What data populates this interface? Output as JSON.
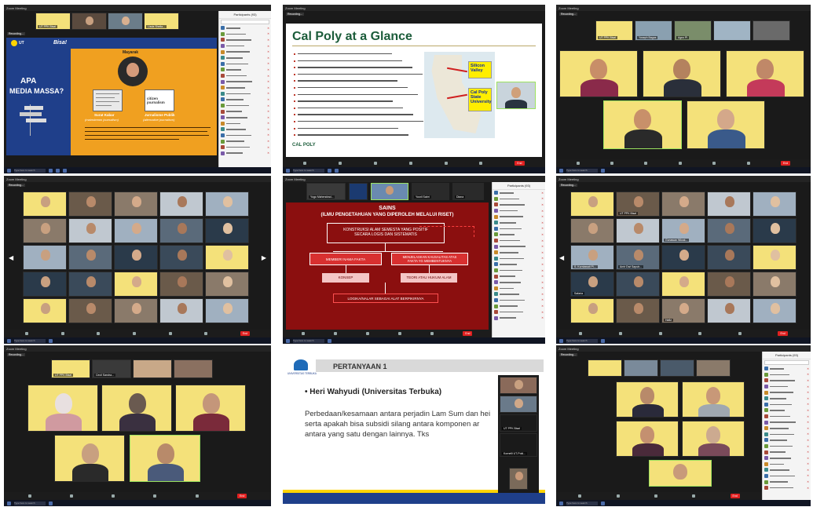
{
  "panel1": {
    "tile_names": [
      "UT PPK Bisa!",
      "",
      "Lisda Sheila..."
    ],
    "slide": {
      "question_line1": "APA",
      "question_line2": "MEDIA MASSA?",
      "center_label": "Mayarak",
      "left_caption_title": "Surat Kabar",
      "left_caption_sub": "(mainstream journalism)",
      "right_caption_title": "Jurnalisme Publik",
      "right_caption_sub": "(alternative journalism)",
      "citizen_label": "citizen journalism",
      "brand": "Bisa!",
      "logo_mark": "UT"
    },
    "participants_title": "Participants (93)"
  },
  "panel2": {
    "slide_title": "Cal Poly at a Glance",
    "callout1": "Silicon Valley",
    "callout2": "Cal Poly State University",
    "footer_logo": "CAL POLY"
  },
  "panel3": {
    "tile_names": [
      "UT PPK Bisa!",
      "Yoseph Bagas",
      "Agus PI"
    ]
  },
  "panel4": {},
  "panel5": {
    "tile_names": [
      "Yogo Mahendrad...",
      "Yusril Sabri",
      "Diana"
    ],
    "slide": {
      "title_line1": "SAINS",
      "title_line2": "(ILMU PENGETAHUAN YANG DIPEROLEH MELALUI RISET)",
      "box_top_line1": "KONSTRUKSI ALAM SEMESTA YANG POSITIF",
      "box_top_line2": "SECARA LOGIS DAN SISTEMATIS",
      "box_left": "MEMBERI NAMA FAKTA",
      "box_right_line1": "MENJELASKAN KAUSALITAS ATAS",
      "box_right_line2": "FAKTA YG MEMBENTUKNYA",
      "sub_left": "KONSEP",
      "sub_right": "TEORI ATAU HUKUM ALAM",
      "box_bottom": "LOGIKA/NALAR SEBAGAI ALAT BERPIKIRNYA"
    },
    "participants_title": "Participants (93)"
  },
  "panel6": {
    "tile_names": [
      "UT PPK Bisa!",
      "Gunawan Wicak...",
      "S. Kurniawati Pl...",
      "Amir Dwi Saputr...",
      "Hafiz",
      "Safaria"
    ]
  },
  "panel7": {
    "tile_names": [
      "UT PPK Bisa!",
      "Cecil Sandra..."
    ]
  },
  "panel8": {
    "slide_title": "PERTANYAAN 1",
    "asker": "• Heri Wahyudi (Universitas Terbuka)",
    "body_line1": "Perbedaan/kesamaan antara perjadin Lam Sum dan hei",
    "body_line2": "serta apakah bisa subsidi silang antara komponen ar",
    "body_line3": "antara yang satu dengan lainnya. Tks",
    "univ_label": "UNIVERSITAS TERBUKA",
    "strip_names": [
      "UT PPK Bisa!",
      "Kornelli UT-Pokl..."
    ]
  },
  "panel9": {
    "participants_title": "Participants (93)"
  },
  "common": {
    "window_title": "Zoom Meeting",
    "recording_label": "Recording...",
    "end_label": "End",
    "search_placeholder": "Type here to search",
    "ctrl_labels": [
      "Unmute",
      "Start Video",
      "Security",
      "Participants",
      "Chat",
      "Share Screen",
      "Record",
      "Reactions",
      "Apps"
    ]
  },
  "colors": {
    "zoom_dark": "#1a1a1a",
    "slide_orange": "#f0a020",
    "slide_blue_band": "#1f3f8a",
    "ut_yellow": "#f4e17a",
    "speaker_green": "#9be25e",
    "red_slide": "#8b0f0f"
  }
}
